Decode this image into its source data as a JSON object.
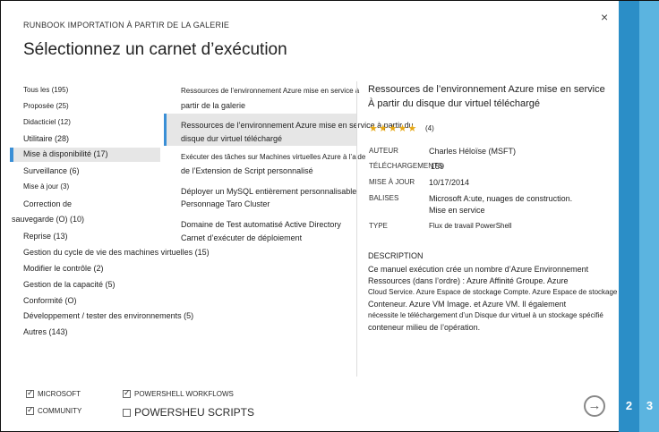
{
  "dialog": {
    "subtitle": "RUNBOOK IMPORTATION À PARTIR DE LA GALERIE",
    "title": "Sélectionnez un carnet d’exécution",
    "close": "×"
  },
  "categories": [
    {
      "label": "Tous les (195)"
    },
    {
      "label": "Proposée (25)"
    },
    {
      "label": "Didacticiel (12)"
    },
    {
      "label": "Utilitaire (28)"
    },
    {
      "label": "Mise à disponibilité (17)",
      "selected": true
    },
    {
      "label": "Surveillance (6)"
    },
    {
      "label": "Mise à jour (3)"
    },
    {
      "label": "Correction de"
    },
    {
      "label": "sauvegarde (O) (10)"
    },
    {
      "label": "Reprise (13)"
    },
    {
      "label": "Gestion du cycle de vie des machines virtuelles (15)"
    },
    {
      "label": "Modifier le contrôle (2)"
    },
    {
      "label": "Gestion de la capacité (5)"
    },
    {
      "label": "Conformité (O)"
    },
    {
      "label": "Développement / tester des environnements (5)"
    },
    {
      "label": "Autres (143)"
    }
  ],
  "runbooks": [
    {
      "line1": "Ressources de l’environnement Azure mise en service à",
      "line2": "partir de la galerie"
    },
    {
      "line1": "Ressources de l’environnement Azure mise en service à partir du",
      "line2": "disque dur virtuel téléchargé",
      "selected": true
    },
    {
      "line1": "Exécuter des tâches sur Machines virtuelles Azure à l’aide",
      "line2": "de l’Extension de Script personnalisé"
    },
    {
      "line1": "Déployer un MySQL entièrement personnalisable",
      "line2": "Personnage Taro Cluster"
    },
    {
      "line1": "Domaine de Test automatisé Active Directory",
      "line2": "Carnet d’exécuter de déploiement"
    }
  ],
  "details": {
    "title_line1": "Ressources de l’environnement Azure mise en service",
    "title_line2": "À partir du disque dur virtuel téléchargé",
    "stars": "★★★★★",
    "rating_count": "(4)",
    "author_label": "AUTEUR",
    "author_value": "Charles Héloïse (MSFT)",
    "downloads_label": "TÉLÉCHARGEMENTS",
    "downloads_value": "159",
    "updated_label": "MISE À JOUR",
    "updated_value": "10/17/2014",
    "tags_label": "BALISES",
    "tags_line1": "Microsoft A:ute, nuages de construction.",
    "tags_line2": "Mise en service",
    "type_label": "TYPE",
    "type_value": "Flux de travail PowerShell",
    "description_label": "DESCRIPTION",
    "desc_lines": [
      "Ce manuel exécution crée un nombre d’Azure    Environnement",
      "Ressources (dans l’ordre) :   Azure   Affinité   Groupe.  Azure",
      "Cloud   Service.  Azure   Espace de stockage   Compte.   Azure   Espace de stockage",
      "Conteneur.   Azure   VM   Image. et         Azure   VM.   Il également",
      "nécessite le téléchargement d’un   Disque dur virtuel à un stockage spécifié",
      "conteneur milieu de l’opération."
    ]
  },
  "filters": {
    "microsoft": {
      "label": "MICROSOFT",
      "checked": true
    },
    "community": {
      "label": "COMMUNITY",
      "checked": true
    },
    "powershell_workflows": {
      "label": "POWERSHELL WORKFLOWS",
      "checked": true
    },
    "powershell_scripts": {
      "label": "POWERSHEU SCRIPTS",
      "checked": false
    }
  },
  "steps": {
    "step2": "2",
    "step3": "3"
  },
  "next_icon": "→",
  "colors": {
    "accent": "#3a8fd6",
    "step_active": "#2b8ec7",
    "step_next": "#5bb4e0",
    "stars": "#e6a817"
  }
}
